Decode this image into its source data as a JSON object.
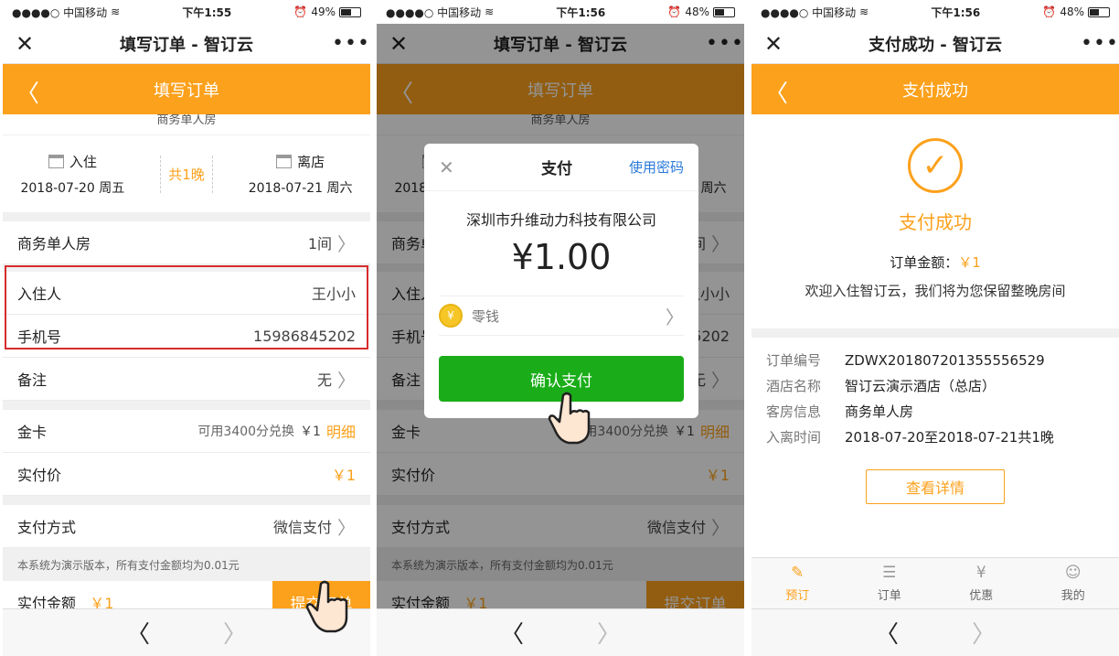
{
  "status": {
    "p1": {
      "carrier": "●●●●○ 中国移动",
      "time": "下午1:55",
      "battery": "49%"
    },
    "p2": {
      "carrier": "●●●●○ 中国移动",
      "time": "下午1:56",
      "battery": "48%"
    },
    "p3": {
      "carrier": "●●●●○ 中国移动",
      "time": "下午1:56",
      "battery": "48%"
    }
  },
  "page1": {
    "window_title": "填写订单 - 智订云",
    "nav_title": "填写订单",
    "room_cut": "商务单人房",
    "checkin_label": "入住",
    "checkin_date": "2018-07-20 周五",
    "nights": "共1晚",
    "checkout_label": "离店",
    "checkout_date": "2018-07-21 周六",
    "room_type": "商务单人房",
    "room_count": "1间",
    "guest_label": "入住人",
    "guest_value": "王小小",
    "phone_label": "手机号",
    "phone_value": "15986845202",
    "remark_label": "备注",
    "remark_value": "无",
    "card_label": "金卡",
    "card_points": "可用3400分兑换",
    "card_amount": "￥1",
    "card_detail": "明细",
    "actual_label": "实付价",
    "actual_value": "￥1",
    "pay_method_label": "支付方式",
    "pay_method_value": "微信支付",
    "demo_note": "本系统为演示版本，所有支付金额均为0.01元",
    "total_label": "实付金额",
    "total_value": "￥1",
    "submit_label": "提交订单"
  },
  "page2": {
    "modal_title": "支付",
    "modal_password": "使用密码",
    "merchant": "深圳市升维动力科技有限公司",
    "amount": "¥1.00",
    "coin_symbol": "¥",
    "pay_source": "零钱",
    "confirm_label": "确认支付"
  },
  "page3": {
    "window_title": "支付成功 - 智订云",
    "nav_title": "支付成功",
    "success_title": "支付成功",
    "order_amount_label": "订单金额：",
    "order_amount_value": "￥1",
    "welcome": "欢迎入住智订云，我们将为您保留整晚房间",
    "details": [
      {
        "key": "订单编号",
        "value": "ZDWX201807201355556529"
      },
      {
        "key": "酒店名称",
        "value": "智订云演示酒店（总店）"
      },
      {
        "key": "客房信息",
        "value": "商务单人房"
      },
      {
        "key": "入离时间",
        "value": "2018-07-20至2018-07-21共1晚"
      }
    ],
    "detail_button": "查看详情",
    "tabs": [
      {
        "label": "预订",
        "icon": "edit-icon",
        "active": true
      },
      {
        "label": "订单",
        "icon": "document-icon",
        "active": false
      },
      {
        "label": "优惠",
        "icon": "coupon-icon",
        "active": false
      },
      {
        "label": "我的",
        "icon": "user-icon",
        "active": false
      }
    ]
  },
  "icons": {
    "close": "close-icon",
    "more": "more-icon",
    "back": "back-arrow-icon",
    "check": "checkmark-icon",
    "hand": "pointer-hand-icon"
  },
  "colors": {
    "accent": "#fca11c",
    "wechat_green": "#1aad19",
    "highlight_box": "#d72c2c",
    "link_blue": "#2a7ad8"
  }
}
